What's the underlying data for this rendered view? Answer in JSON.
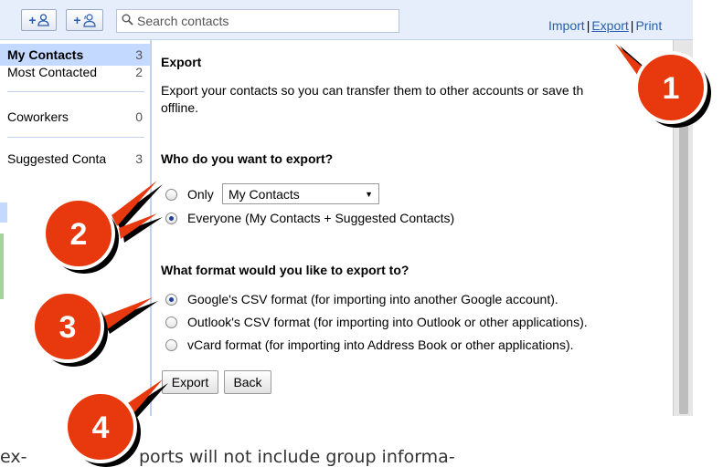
{
  "toolbar": {
    "add_contact_label": "+",
    "add_group_label": "+",
    "search_placeholder": "Search contacts",
    "links": {
      "import": "Import",
      "export": "Export",
      "print": "Print",
      "separator": "|"
    }
  },
  "sidebar": {
    "items": [
      {
        "label": "My Contacts",
        "count": "3"
      },
      {
        "label": "Most Contacted",
        "count": "2"
      },
      {
        "label": "Coworkers",
        "count": "0"
      },
      {
        "label": "Suggested Conta",
        "count": "3"
      }
    ]
  },
  "main": {
    "title": "Export",
    "description_line1": "Export your contacts so you can transfer them to other accounts or save th",
    "description_line2": "offline.",
    "who_heading": "Who do you want to export?",
    "who_options": [
      {
        "label": "Only",
        "selected": false
      },
      {
        "label": "Everyone (My Contacts + Suggested Contacts)",
        "selected": true
      }
    ],
    "group_select_value": "My Contacts",
    "format_heading": "What format would you like to export to?",
    "format_options": [
      {
        "label": "Google's CSV format (for importing into another Google account).",
        "selected": true
      },
      {
        "label": "Outlook's CSV format (for importing into Outlook or other applications).",
        "selected": false
      },
      {
        "label": "vCard format (for importing into Address Book or other applications).",
        "selected": false
      }
    ],
    "export_button": "Export",
    "back_button": "Back"
  },
  "callouts": [
    "1",
    "2",
    "3",
    "4"
  ],
  "footer": {
    "left": "ex-",
    "right": "ports will not include group informa-"
  },
  "colors": {
    "link": "#2a5db0",
    "callout": "#e8380d",
    "toolbar_bg": "#e7eefb",
    "selected_bg": "#c3d9ff"
  }
}
